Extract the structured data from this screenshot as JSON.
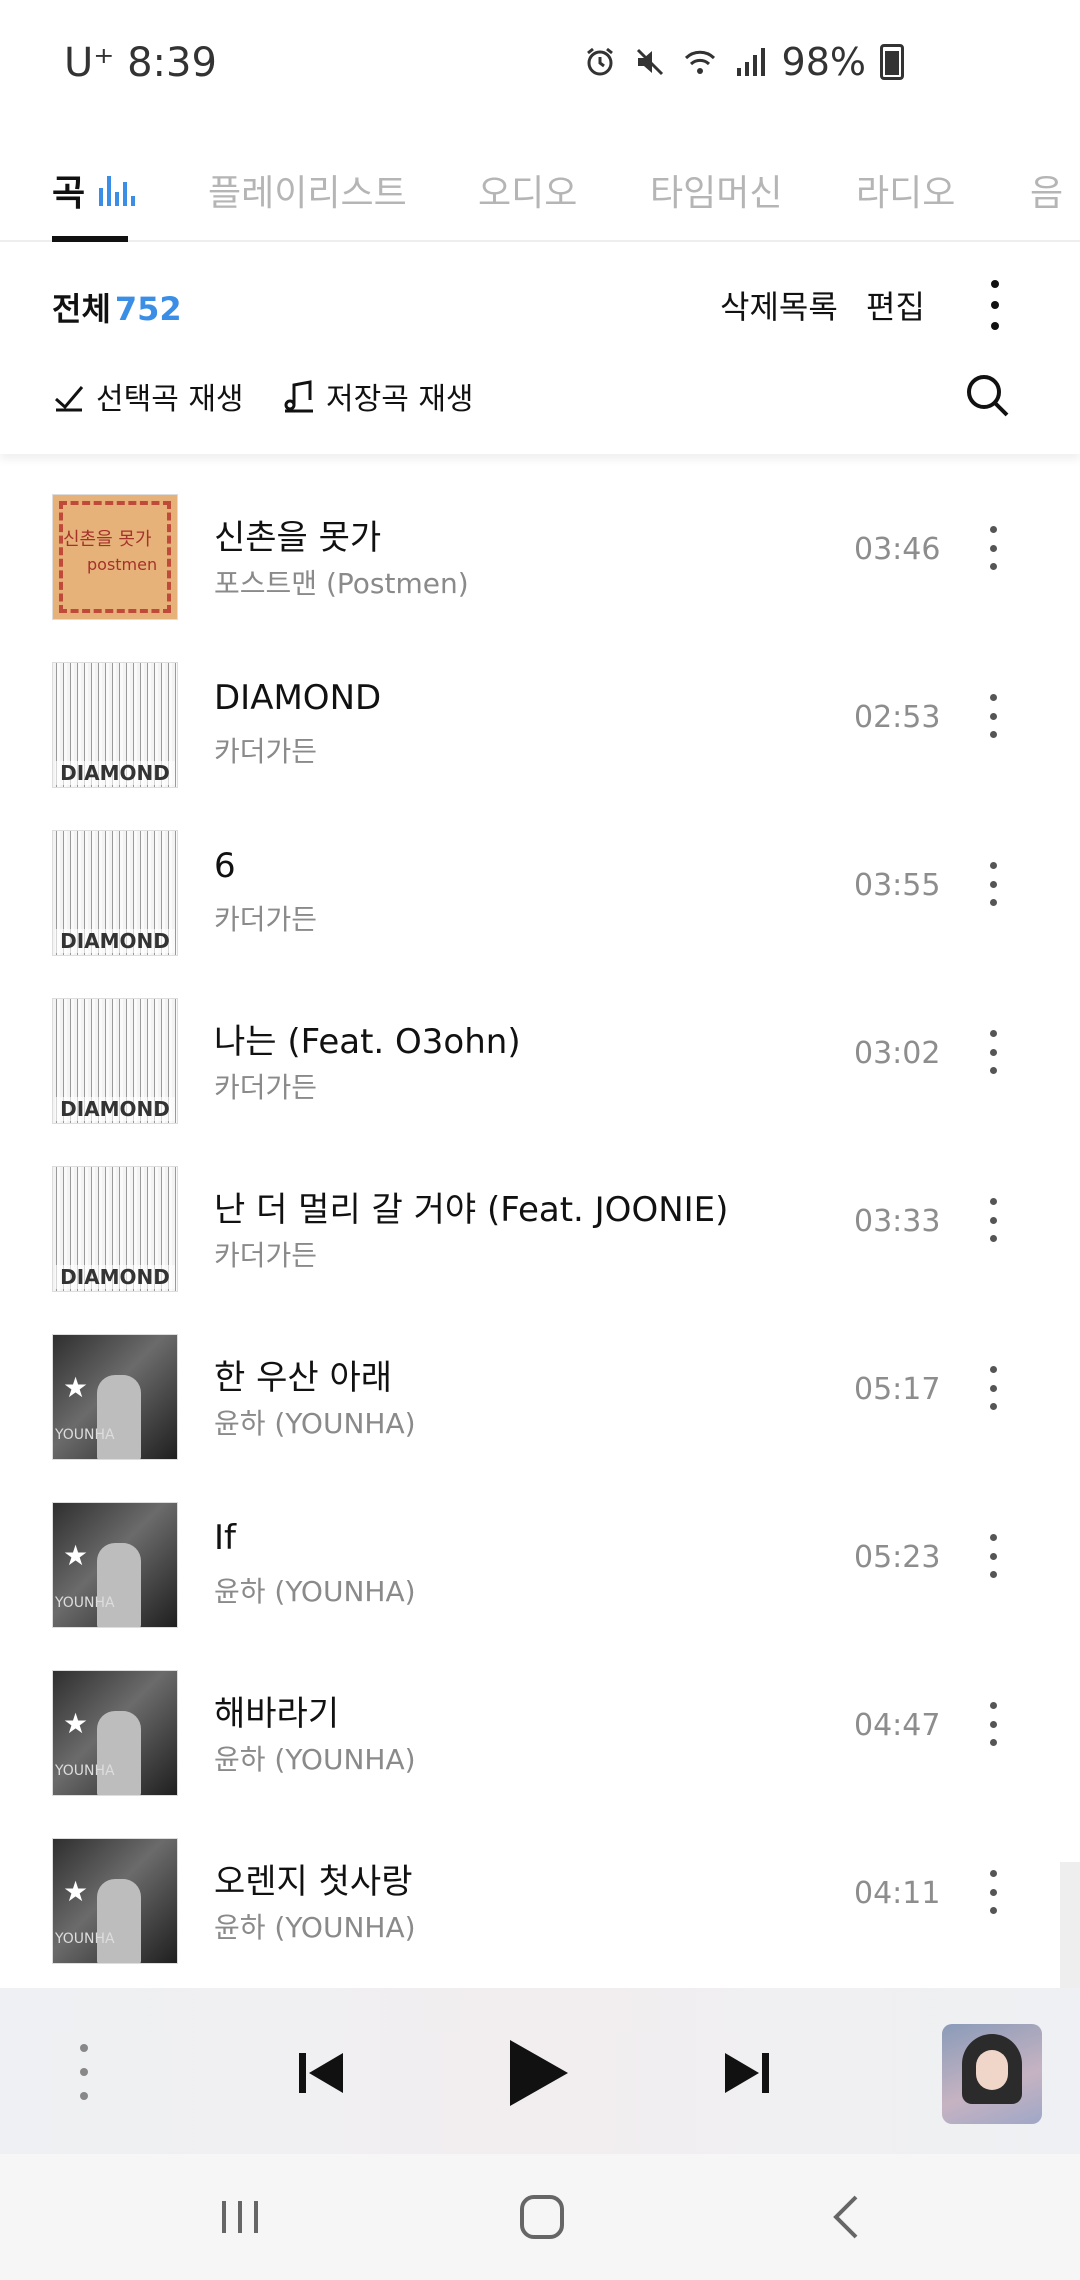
{
  "status_bar": {
    "carrier_time": "U⁺ 8:39",
    "battery": "98%",
    "icons": [
      "alarm-icon",
      "mute-icon",
      "wifi-icon",
      "signal-icon",
      "battery-charging-icon"
    ]
  },
  "tabs": [
    {
      "label": "곡",
      "active": true
    },
    {
      "label": "플레이리스트",
      "active": false
    },
    {
      "label": "오디오",
      "active": false
    },
    {
      "label": "타임머신",
      "active": false
    },
    {
      "label": "라디오",
      "active": false
    },
    {
      "label": "음",
      "active": false
    }
  ],
  "header": {
    "total_label": "전체",
    "total_count": "752",
    "deleted_list": "삭제목록",
    "edit": "편집",
    "play_selected": "선택곡 재생",
    "play_saved": "저장곡 재생"
  },
  "songs": [
    {
      "title": "신촌을 못가",
      "artist": "포스트맨 (Postmen)",
      "duration": "03:46",
      "art": "postmen",
      "art_text": "신촌을 못가",
      "art_sub": "postmen"
    },
    {
      "title": "DIAMOND",
      "artist": "카더가든",
      "duration": "02:53",
      "art": "diamond",
      "art_text": "DIAMOND"
    },
    {
      "title": "6",
      "artist": "카더가든",
      "duration": "03:55",
      "art": "diamond",
      "art_text": "DIAMOND"
    },
    {
      "title": "나는 (Feat. O3ohn)",
      "artist": "카더가든",
      "duration": "03:02",
      "art": "diamond",
      "art_text": "DIAMOND"
    },
    {
      "title": "난 더 멀리 갈 거야 (Feat. JOONIE)",
      "artist": "카더가든",
      "duration": "03:33",
      "art": "diamond",
      "art_text": "DIAMOND"
    },
    {
      "title": "한 우산 아래",
      "artist": "윤하 (YOUNHA)",
      "duration": "05:17",
      "art": "younha",
      "art_text": "YOUNHA"
    },
    {
      "title": "If",
      "artist": "윤하 (YOUNHA)",
      "duration": "05:23",
      "art": "younha",
      "art_text": "YOUNHA"
    },
    {
      "title": "해바라기",
      "artist": "윤하 (YOUNHA)",
      "duration": "04:47",
      "art": "younha",
      "art_text": "YOUNHA"
    },
    {
      "title": "오렌지 첫사랑",
      "artist": "윤하 (YOUNHA)",
      "duration": "04:11",
      "art": "younha",
      "art_text": "YOUNHA"
    }
  ],
  "player": {
    "icons": [
      "more-icon",
      "previous-icon",
      "play-icon",
      "next-icon",
      "album-cover"
    ]
  },
  "navbar": {
    "icons": [
      "recent-apps-icon",
      "home-icon",
      "back-icon"
    ]
  },
  "colors": {
    "accent": "#3a8ee6",
    "inactive_tab": "#b5b5b5",
    "secondary_text": "#8a8a8a"
  }
}
